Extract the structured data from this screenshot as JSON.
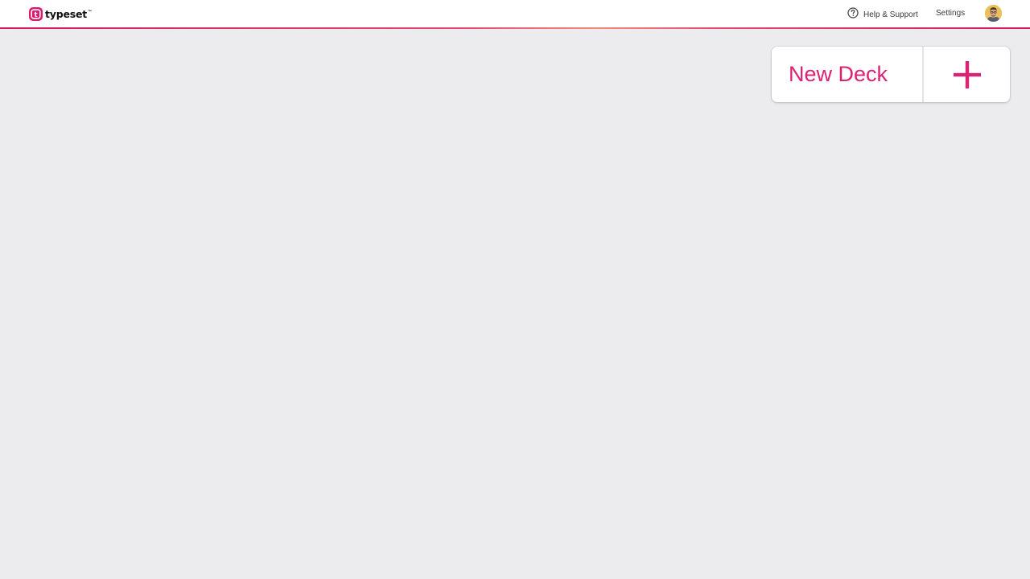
{
  "brand": {
    "name": "typeset",
    "trademark": "™",
    "logo_letter": "t",
    "accent_color": "#dc2273"
  },
  "nav": {
    "help_icon": "question-circle-icon",
    "help_label": "Help & Support",
    "settings_label": "Settings",
    "avatar_icon": "user-avatar"
  },
  "main": {
    "new_deck_label": "New Deck",
    "new_deck_icon": "plus-icon"
  },
  "colors": {
    "background": "#ecebee",
    "topbar": "#ffffff",
    "accent": "#dc2273"
  }
}
